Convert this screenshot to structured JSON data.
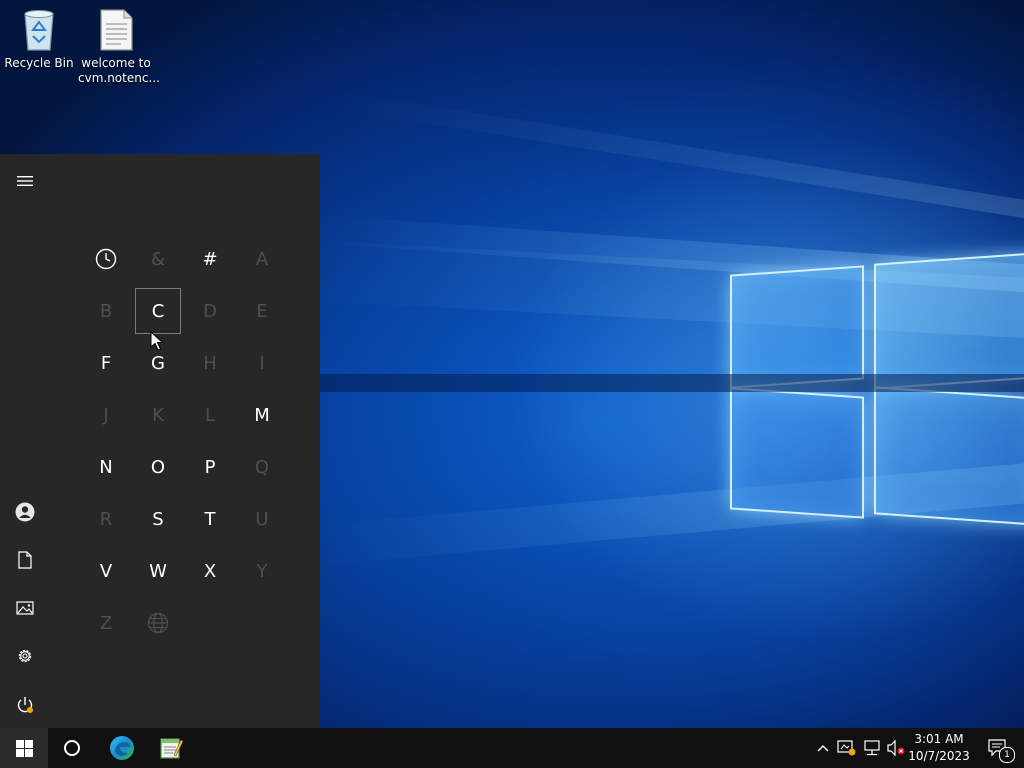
{
  "desktop": {
    "icons": [
      {
        "label": "Recycle Bin",
        "icon": "recycle-bin-icon"
      },
      {
        "label": "welcome to cvm.notenc...",
        "line1": "welcome to",
        "line2": "cvm.notenc...",
        "icon": "text-file-icon"
      }
    ]
  },
  "start_menu": {
    "rail": [
      {
        "name": "expand-menu",
        "icon": "hamburger-icon"
      },
      {
        "name": "account",
        "icon": "user-icon"
      },
      {
        "name": "documents",
        "icon": "document-icon"
      },
      {
        "name": "pictures",
        "icon": "picture-icon"
      },
      {
        "name": "settings",
        "icon": "gear-icon"
      },
      {
        "name": "power",
        "icon": "power-icon"
      }
    ],
    "letter_grid": [
      {
        "label": "recent",
        "icon": "clock-icon",
        "enabled": true
      },
      {
        "label": "&",
        "enabled": false
      },
      {
        "label": "#",
        "enabled": true
      },
      {
        "label": "A",
        "enabled": false
      },
      {
        "label": "B",
        "enabled": false
      },
      {
        "label": "C",
        "enabled": true,
        "hovered": true
      },
      {
        "label": "D",
        "enabled": false
      },
      {
        "label": "E",
        "enabled": false
      },
      {
        "label": "F",
        "enabled": true
      },
      {
        "label": "G",
        "enabled": true
      },
      {
        "label": "H",
        "enabled": false
      },
      {
        "label": "I",
        "enabled": false
      },
      {
        "label": "J",
        "enabled": false
      },
      {
        "label": "K",
        "enabled": false
      },
      {
        "label": "L",
        "enabled": false
      },
      {
        "label": "M",
        "enabled": true
      },
      {
        "label": "N",
        "enabled": true
      },
      {
        "label": "O",
        "enabled": true
      },
      {
        "label": "P",
        "enabled": true
      },
      {
        "label": "Q",
        "enabled": false
      },
      {
        "label": "R",
        "enabled": false
      },
      {
        "label": "S",
        "enabled": true
      },
      {
        "label": "T",
        "enabled": true
      },
      {
        "label": "U",
        "enabled": false
      },
      {
        "label": "V",
        "enabled": true
      },
      {
        "label": "W",
        "enabled": true
      },
      {
        "label": "X",
        "enabled": true
      },
      {
        "label": "Y",
        "enabled": false
      },
      {
        "label": "Z",
        "enabled": false
      },
      {
        "label": "globe",
        "icon": "globe-icon",
        "enabled": false
      }
    ]
  },
  "taskbar": {
    "buttons": [
      {
        "name": "start",
        "icon": "windows-logo-icon"
      },
      {
        "name": "search",
        "icon": "cortana-circle-icon"
      },
      {
        "name": "edge",
        "icon": "edge-icon"
      },
      {
        "name": "notepad-app",
        "icon": "notepad-icon"
      }
    ],
    "tray": {
      "icons": [
        "chevron-up-icon",
        "security-warning-icon",
        "network-icon",
        "volume-muted-icon"
      ],
      "time": "3:01 AM",
      "date": "10/7/2023",
      "notification_count": "1"
    }
  },
  "colors": {
    "start_menu_bg": "#272727",
    "taskbar_bg": "#101010",
    "letter_enabled": "#ffffff",
    "letter_disabled": "#4f4f4f",
    "warning_dot": "#f7a11a",
    "mute_badge": "#e81123"
  }
}
